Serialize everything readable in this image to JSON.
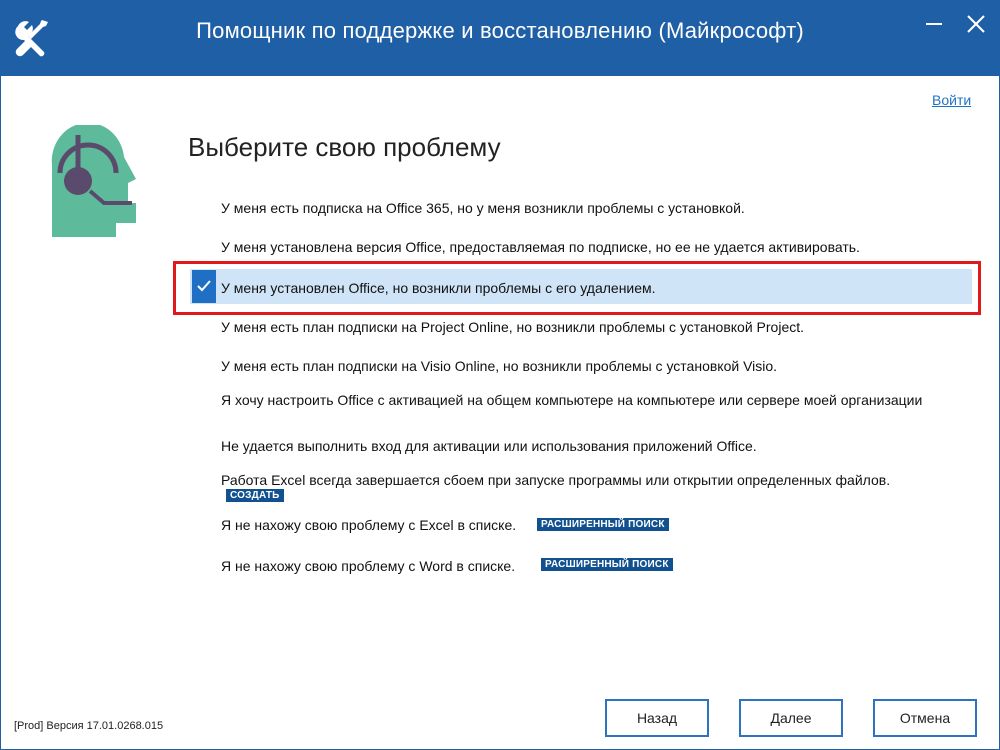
{
  "window": {
    "title": "Помощник по поддержке и восстановлению (Майкрософт)",
    "minimize_icon": "minimize-icon",
    "close_icon": "close-icon",
    "accent_color": "#1f5fa6"
  },
  "header": {
    "signin_label": "Войти"
  },
  "main": {
    "heading": "Выберите свою проблему",
    "options": [
      {
        "label": "У меня есть подписка на Office 365, но у меня возникли проблемы с установкой."
      },
      {
        "label": "У меня установлена версия Office, предоставляемая по подписке, но ее не удается активировать."
      },
      {
        "label": "У меня установлен Office, но возникли проблемы с его удалением.",
        "selected": true
      },
      {
        "label": "У меня есть план подписки на Project Online, но возникли проблемы с установкой Project."
      },
      {
        "label": "У меня есть план подписки на Visio Online, но возникли проблемы с установкой Visio."
      },
      {
        "label": "Я хочу настроить Office с активацией на общем компьютере на компьютере или сервере моей организации"
      },
      {
        "label": "Не удается выполнить вход для активации или использования приложений Office."
      },
      {
        "label": "Работа Excel всегда завершается сбоем при запуске программы или открытии определенных файлов.",
        "badge": "СОЗДАТЬ"
      },
      {
        "label": "Я не нахожу свою проблему с Excel в списке.",
        "badge": "РАСШИРЕННЫЙ ПОИСК"
      },
      {
        "label": "Я не нахожу свою проблему с Word в списке.",
        "badge": "РАСШИРЕННЫЙ ПОИСК"
      }
    ],
    "selection_highlight_color": "#e0191b"
  },
  "footer": {
    "version": "[Prod] Версия 17.01.0268.015",
    "back_label": "Назад",
    "next_label": "Далее",
    "cancel_label": "Отмена"
  }
}
